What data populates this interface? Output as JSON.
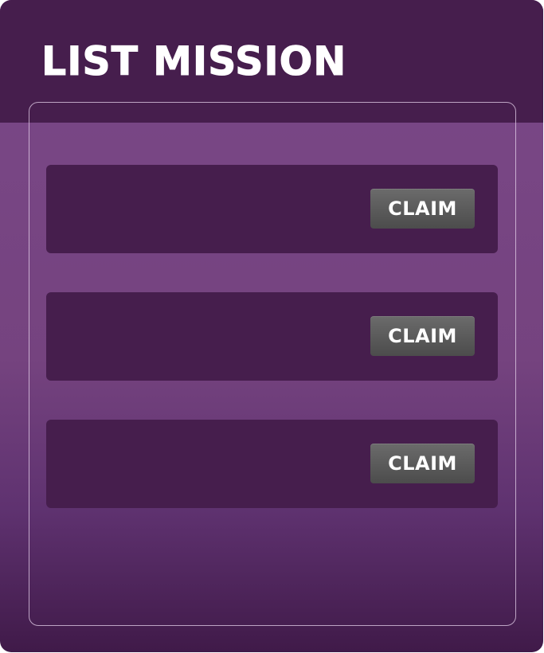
{
  "panel": {
    "title": "LIST MISSION"
  },
  "missions": [
    {
      "claim_label": "CLAIM"
    },
    {
      "claim_label": "CLAIM"
    },
    {
      "claim_label": "CLAIM"
    }
  ],
  "colors": {
    "header": "#461e4d",
    "panel": "#7a4888",
    "card": "#461e4d",
    "button": "#5a5a5a",
    "text": "#ffffff"
  }
}
